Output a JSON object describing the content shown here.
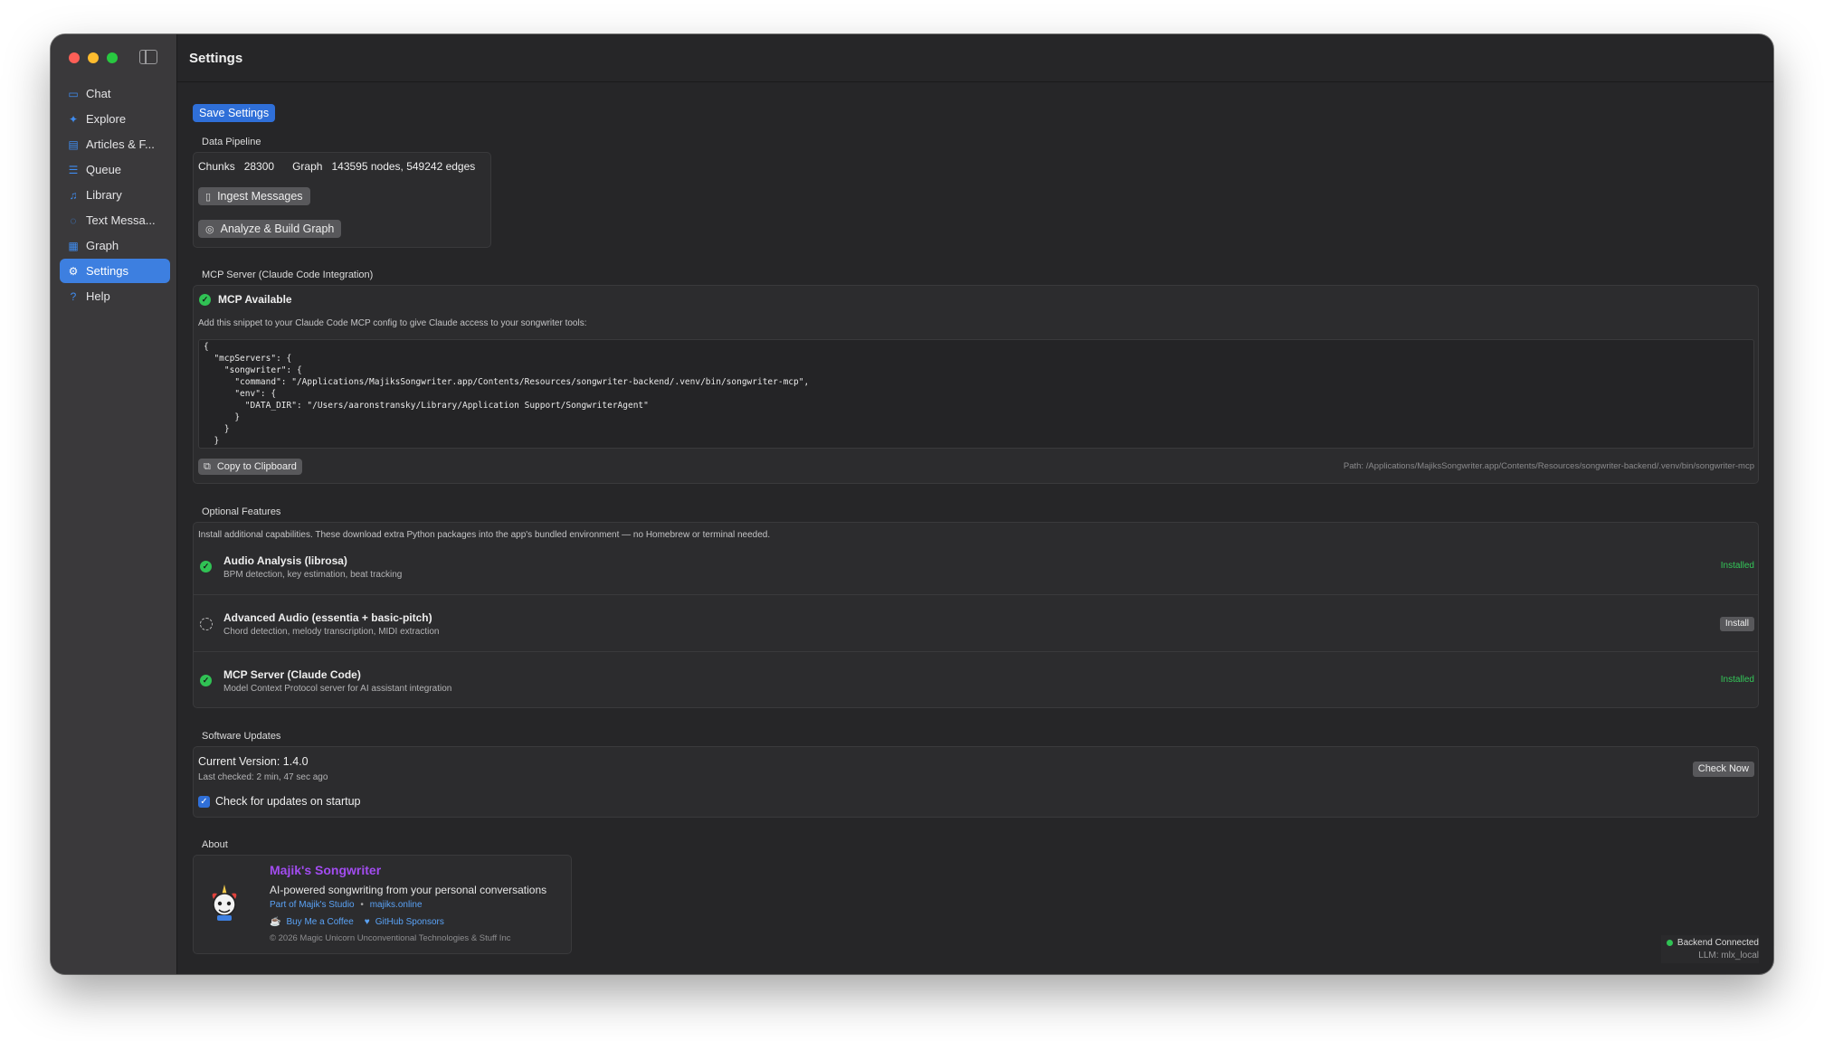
{
  "window": {
    "title": "Settings"
  },
  "sidebar": {
    "items": [
      {
        "label": "Chat",
        "icon": "chat-icon",
        "glyph": "▭"
      },
      {
        "label": "Explore",
        "icon": "sparkles-icon",
        "glyph": "✦"
      },
      {
        "label": "Articles & F...",
        "icon": "newspaper-icon",
        "glyph": "▤"
      },
      {
        "label": "Queue",
        "icon": "list-icon",
        "glyph": "☰"
      },
      {
        "label": "Library",
        "icon": "music-note-icon",
        "glyph": "♫"
      },
      {
        "label": "Text Messa...",
        "icon": "message-bubble-icon",
        "glyph": "◌"
      },
      {
        "label": "Graph",
        "icon": "grid-icon",
        "glyph": "▦"
      },
      {
        "label": "Settings",
        "icon": "gear-icon",
        "glyph": "⚙",
        "active": true
      },
      {
        "label": "Help",
        "icon": "question-icon",
        "glyph": "?"
      }
    ]
  },
  "actions": {
    "save_label": "Save Settings"
  },
  "pipeline": {
    "section_label": "Data Pipeline",
    "chunks_label": "Chunks",
    "chunks_value": "28300",
    "graph_label": "Graph",
    "graph_value": "143595 nodes, 549242 edges",
    "ingest_label": "Ingest Messages",
    "analyze_label": "Analyze & Build Graph"
  },
  "mcp": {
    "section_label": "MCP Server (Claude Code Integration)",
    "status": "MCP Available",
    "hint": "Add this snippet to your Claude Code MCP config to give Claude access to your songwriter tools:",
    "snippet": "{\n  \"mcpServers\": {\n    \"songwriter\": {\n      \"command\": \"/Applications/MajiksSongwriter.app/Contents/Resources/songwriter-backend/.venv/bin/songwriter-mcp\",\n      \"env\": {\n        \"DATA_DIR\": \"/Users/aaronstransky/Library/Application Support/SongwriterAgent\"\n      }\n    }\n  }\n}",
    "copy_label": "Copy to Clipboard",
    "path": "Path: /Applications/MajiksSongwriter.app/Contents/Resources/songwriter-backend/.venv/bin/songwriter-mcp"
  },
  "features": {
    "section_label": "Optional Features",
    "intro": "Install additional capabilities. These download extra Python packages into the app's bundled environment — no Homebrew or terminal needed.",
    "items": [
      {
        "title": "Audio Analysis (librosa)",
        "desc": "BPM detection, key estimation, beat tracking",
        "status": "Installed",
        "installed": true
      },
      {
        "title": "Advanced Audio (essentia + basic-pitch)",
        "desc": "Chord detection, melody transcription, MIDI extraction",
        "status": "Install",
        "installed": false
      },
      {
        "title": "MCP Server (Claude Code)",
        "desc": "Model Context Protocol server for AI assistant integration",
        "status": "Installed",
        "installed": true
      }
    ]
  },
  "updates": {
    "section_label": "Software Updates",
    "version": "Current Version: 1.4.0",
    "last_checked": "Last checked: 2 min, 47 sec ago",
    "check_label": "Check Now",
    "startup_label": "Check for updates on startup",
    "startup_checked": true
  },
  "about": {
    "section_label": "About",
    "name": "Majik's Songwriter",
    "tagline": "AI-powered songwriting from your personal conversations",
    "studio_link": "Part of Majik's Studio",
    "separator": "•",
    "site_link": "majiks.online",
    "coffee_link": "Buy Me a Coffee",
    "sponsors_link": "GitHub Sponsors",
    "copyright": "© 2026 Magic Unicorn Unconventional Technologies & Stuff Inc"
  },
  "status": {
    "backend": "Backend Connected",
    "llm": "LLM: mlx_local"
  },
  "colors": {
    "accent": "#3d7fe0",
    "success": "#30c254",
    "brand": "#a24cf0"
  }
}
